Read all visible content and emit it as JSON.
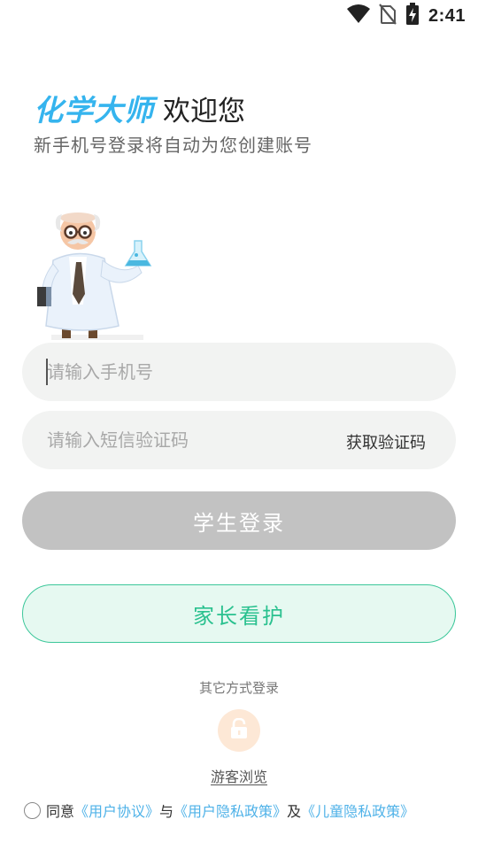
{
  "status_bar": {
    "time": "2:41",
    "icons": [
      "wifi-icon",
      "no-sim-icon",
      "battery-charging-icon"
    ]
  },
  "header": {
    "brand": "化学大师",
    "welcome": "欢迎您",
    "subtitle": "新手机号登录将自动为您创建账号"
  },
  "mascot": {
    "icon": "scientist-mascot-icon"
  },
  "form": {
    "phone": {
      "value": "",
      "placeholder": "请输入手机号"
    },
    "code": {
      "value": "",
      "placeholder": "请输入短信验证码"
    },
    "get_code_label": "获取验证码"
  },
  "buttons": {
    "student_login": "学生登录",
    "parent_care": "家长看护"
  },
  "other_login": {
    "label": "其它方式登录",
    "guest_icon": "lock-icon",
    "guest_label": "游客浏览"
  },
  "agreement": {
    "checked": false,
    "prefix": "同意",
    "user_agreement": "《用户协议》",
    "and1": "与",
    "privacy_policy": "《用户隐私政策》",
    "and2": "及",
    "children_privacy": "《儿童隐私政策》"
  },
  "colors": {
    "brand": "#35b4ee",
    "primary_disabled": "#c2c2c2",
    "parent_green": "#2ac18f",
    "parent_bg": "#e6f9f1",
    "link": "#4fb2e8",
    "field_bg": "#f2f3f2"
  }
}
